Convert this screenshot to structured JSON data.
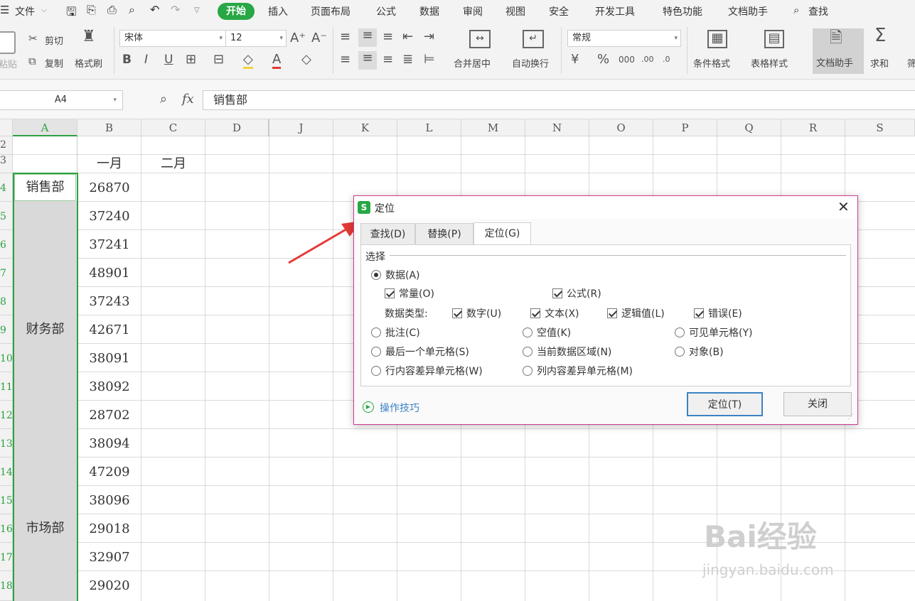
{
  "menubar": {
    "items": [
      "文件",
      "插入",
      "页面布局",
      "公式",
      "数据",
      "审阅",
      "视图",
      "安全",
      "开发工具",
      "特色功能",
      "文档助手",
      "查找"
    ],
    "active_tab": "开始",
    "accent": "#28a745"
  },
  "ribbon": {
    "paste": "粘贴",
    "cut": "剪切",
    "copy": "复制",
    "format_painter": "格式刷",
    "font_name": "宋体",
    "font_size": "12",
    "merge_center": "合并居中",
    "wrap_text": "自动换行",
    "number_format": "常规",
    "cond_format": "条件格式",
    "table_style": "表格样式",
    "doc_assistant": "文档助手",
    "sum": "求和",
    "filter": "筛"
  },
  "formula_bar": {
    "cell_ref": "A4",
    "fx": "fx",
    "value": "销售部"
  },
  "grid": {
    "columns": [
      "A",
      "B",
      "C",
      "D",
      "J",
      "K",
      "L",
      "M",
      "N",
      "O",
      "P",
      "Q",
      "R",
      "S"
    ],
    "rows": [
      "2",
      "3",
      "4",
      "5",
      "6",
      "7",
      "8",
      "9",
      "10",
      "11",
      "12",
      "13",
      "14",
      "15",
      "16",
      "17",
      "18"
    ],
    "header_b": "一月",
    "header_c": "二月",
    "dept_a4": "销售部",
    "dept_a9": "财务部",
    "dept_a16": "市场部",
    "values": [
      "26870",
      "37240",
      "37241",
      "48901",
      "37243",
      "42671",
      "38091",
      "38092",
      "28702",
      "38094",
      "47209",
      "38096",
      "29018",
      "32907",
      "29020"
    ]
  },
  "dialog": {
    "title": "定位",
    "tabs": [
      "查找(D)",
      "替换(P)",
      "定位(G)"
    ],
    "section": "选择",
    "data": "数据(A)",
    "constant": "常量(O)",
    "formula": "公式(R)",
    "data_type": "数据类型:",
    "number": "数字(U)",
    "text": "文本(X)",
    "logical": "逻辑值(L)",
    "error": "错误(E)",
    "comment": "批注(C)",
    "blank": "空值(K)",
    "visible": "可见单元格(Y)",
    "last_cell": "最后一个单元格(S)",
    "current_region": "当前数据区域(N)",
    "object": "对象(B)",
    "row_diff": "行内容差异单元格(W)",
    "col_diff": "列内容差异单元格(M)",
    "tips": "操作技巧",
    "goto_btn": "定位(T)",
    "close_btn": "关闭"
  },
  "watermark": {
    "brand": "Bai经验",
    "url": "jingyan.baidu.com"
  }
}
